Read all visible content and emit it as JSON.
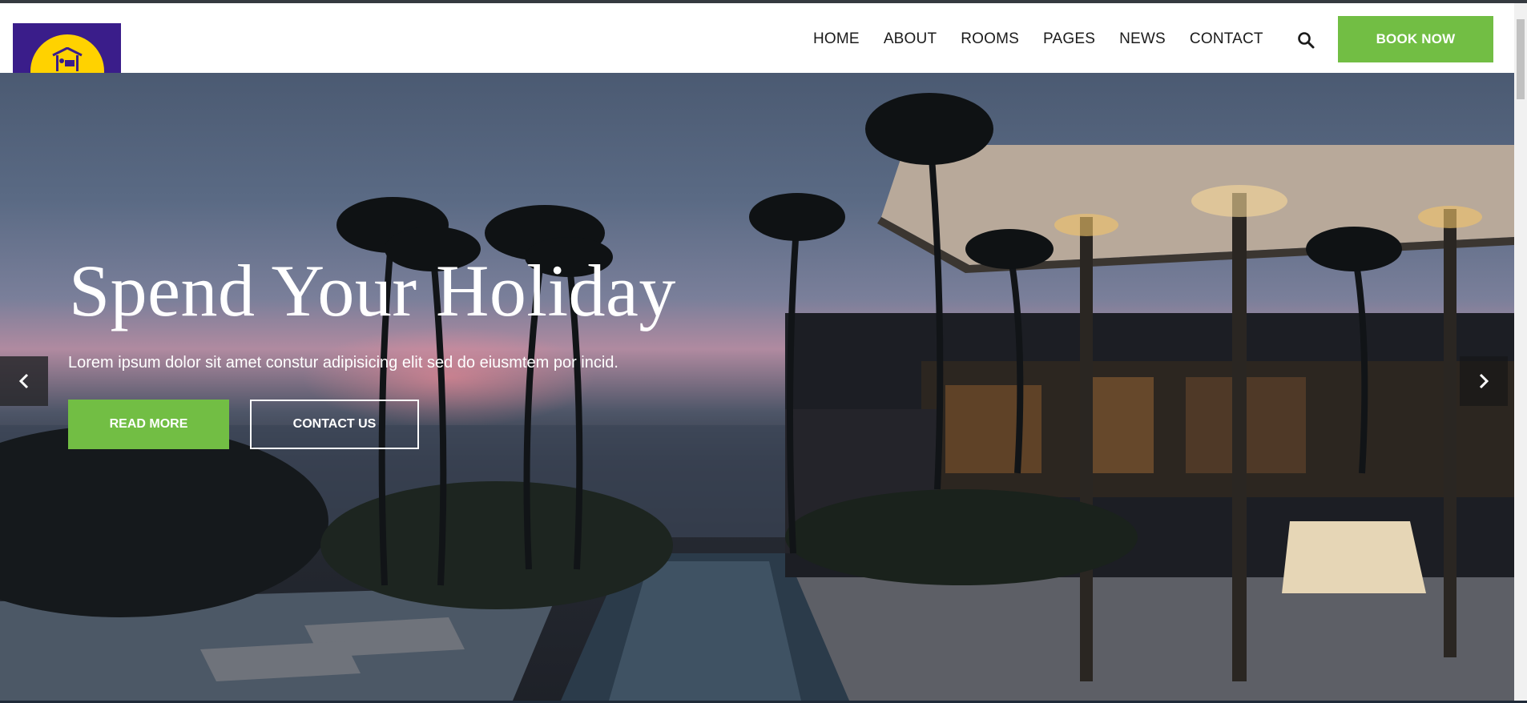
{
  "header": {
    "logo_label": "Hotel logo",
    "nav": [
      {
        "label": "HOME"
      },
      {
        "label": "ABOUT"
      },
      {
        "label": "ROOMS"
      },
      {
        "label": "PAGES"
      },
      {
        "label": "NEWS"
      },
      {
        "label": "CONTACT"
      }
    ],
    "search_icon": "search-icon",
    "book_label": "BOOK NOW"
  },
  "hero": {
    "title": "Spend Your Holiday",
    "subtitle": "Lorem ipsum dolor sit amet constur adipisicing elit sed do eiusmtem por incid.",
    "read_more_label": "READ MORE",
    "contact_label": "CONTACT US",
    "prev_icon": "chevron-left-icon",
    "next_icon": "chevron-right-icon"
  },
  "colors": {
    "accent": "#72be44",
    "logo_bg": "#3a1d8a",
    "logo_sun": "#ffd200"
  }
}
